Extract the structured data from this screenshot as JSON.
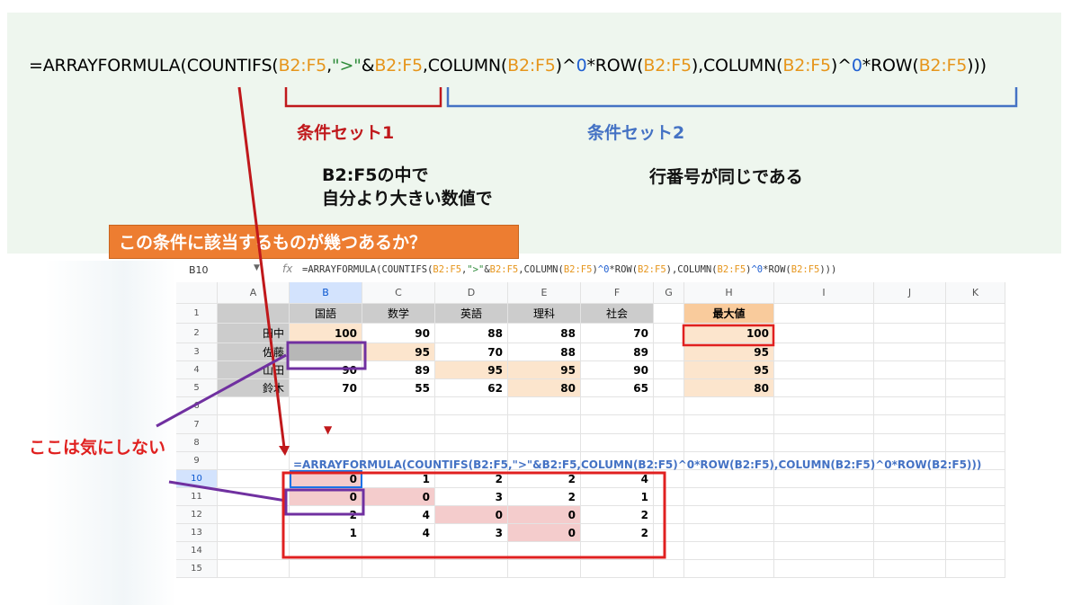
{
  "formula_main": {
    "parts": [
      {
        "t": "=ARRAYFORMULA(COUNTIFS(",
        "c": ""
      },
      {
        "t": "B2:F5",
        "c": "ref"
      },
      {
        "t": ",",
        "c": ""
      },
      {
        "t": "\">\"",
        "c": "str"
      },
      {
        "t": "&",
        "c": ""
      },
      {
        "t": "B2:F5",
        "c": "ref"
      },
      {
        "t": ",COLUMN(",
        "c": ""
      },
      {
        "t": "B2:F5",
        "c": "ref"
      },
      {
        "t": ")^",
        "c": ""
      },
      {
        "t": "0",
        "c": "num"
      },
      {
        "t": "*ROW(",
        "c": ""
      },
      {
        "t": "B2:F5",
        "c": "ref"
      },
      {
        "t": "),COLUMN(",
        "c": ""
      },
      {
        "t": "B2:F5",
        "c": "ref"
      },
      {
        "t": ")^",
        "c": ""
      },
      {
        "t": "0",
        "c": "num"
      },
      {
        "t": "*ROW(",
        "c": ""
      },
      {
        "t": "B2:F5",
        "c": "ref"
      },
      {
        "t": ")))",
        "c": ""
      }
    ]
  },
  "labels": {
    "set1": "条件セット1",
    "set2": "条件セット2",
    "desc1_line1": "B2:F5の中で",
    "desc1_line2": "自分より大きい数値で",
    "desc2": "行番号が同じである",
    "question": "この条件に該当するものが幾つあるか？",
    "callout": "ここは気にしない"
  },
  "colors": {
    "red": "#c0181b",
    "blue": "#4472c4",
    "purple": "#7030a0",
    "orange": "#ed7d31"
  },
  "sheet": {
    "name_box": "B10",
    "fx": "fx",
    "formula_bar": "=ARRAYFORMULA(COUNTIFS(B2:F5,\">\"&B2:F5,COLUMN(B2:F5)^0*ROW(B2:F5),COLUMN(B2:F5)^0*ROW(B2:F5)))",
    "columns": [
      "A",
      "B",
      "C",
      "D",
      "E",
      "F",
      "G",
      "H",
      "I",
      "J",
      "K"
    ],
    "rows": [
      "1",
      "2",
      "3",
      "4",
      "5",
      "6",
      "7",
      "8",
      "9",
      "10",
      "11",
      "12",
      "13",
      "14",
      "15"
    ],
    "header_row": [
      "",
      "国語",
      "数学",
      "英語",
      "理科",
      "社会",
      "",
      "最大値"
    ],
    "names": [
      "田中",
      "佐藤",
      "山田",
      "鈴木"
    ],
    "scores": [
      [
        "100",
        "90",
        "88",
        "88",
        "70"
      ],
      [
        "",
        "95",
        "70",
        "88",
        "89"
      ],
      [
        "90",
        "89",
        "95",
        "95",
        "90"
      ],
      [
        "70",
        "55",
        "62",
        "80",
        "65"
      ]
    ],
    "max_values": [
      "100",
      "95",
      "95",
      "80"
    ],
    "formula_row8": "=ARRAYFORMULA(COUNTIFS(B2:F5,\">\"&B2:F5,COLUMN(B2:F5)^0*ROW(B2:F5),COLUMN(B2:F5)^0*ROW(B2:F5)))",
    "results": [
      [
        "0",
        "1",
        "2",
        "2",
        "4"
      ],
      [
        "0",
        "0",
        "3",
        "2",
        "1"
      ],
      [
        "2",
        "4",
        "0",
        "0",
        "2"
      ],
      [
        "1",
        "4",
        "3",
        "0",
        "2"
      ]
    ],
    "small_marker": "▼"
  }
}
